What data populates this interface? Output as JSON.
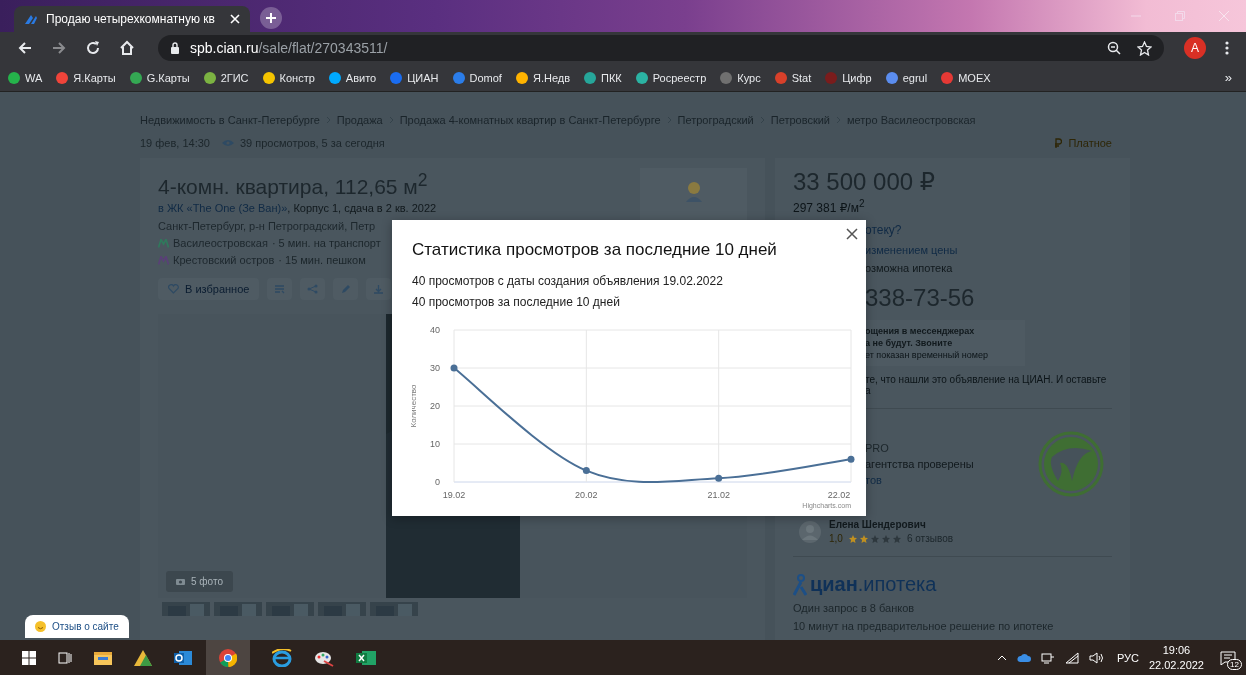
{
  "browser": {
    "tab": {
      "title": "Продаю четырехкомнатную кв",
      "selected": true
    },
    "url": {
      "host": "spb.cian.ru",
      "path": "/sale/flat/270343511/"
    },
    "profile_initial": "A",
    "bookmarks": [
      {
        "label": "WA",
        "color": "#25b34b"
      },
      {
        "label": "Я.Карты",
        "color": "#f0443a"
      },
      {
        "label": "G.Карты",
        "color": "#34a853"
      },
      {
        "label": "2ГИС",
        "color": "#7cb342"
      },
      {
        "label": "Констр",
        "color": "#f5c400"
      },
      {
        "label": "Авито",
        "color": "#00aaff"
      },
      {
        "label": "ЦИАН",
        "color": "#1a6cf0"
      },
      {
        "label": "Domof",
        "color": "#2b7de9"
      },
      {
        "label": "Я.Недв",
        "color": "#ffb300"
      },
      {
        "label": "ПКК",
        "color": "#26a69a"
      },
      {
        "label": "Росреестр",
        "color": "#2bb3a3"
      },
      {
        "label": "Курс",
        "color": "#707070"
      },
      {
        "label": "Stat",
        "color": "#d8402a"
      },
      {
        "label": "Цифр",
        "color": "#7a1c1c"
      },
      {
        "label": "egrul",
        "color": "#5b8def"
      },
      {
        "label": "MOEX",
        "color": "#e53935"
      }
    ],
    "bookmarks_more": "»"
  },
  "page": {
    "breadcrumbs": [
      "Недвижимость в Санкт-Петербурге",
      "Продажа",
      "Продажа 4-комнатных квартир в Санкт-Петербурге",
      "Петроградский",
      "Петровский",
      "метро Василеостровская"
    ],
    "published": "19 фев, 14:30",
    "views": "39 просмотров, 5 за сегодня",
    "paid_label": "Платное",
    "listing": {
      "title": "4-комн. квартира, 112,65 м$^{2}$",
      "complex_link": "в ЖК «The One (Зе Ван)»",
      "complex_details": ", Корпус 1, сдача в 2 кв. 2022",
      "address": "Санкт-Петербург, р-н Петроградский, Петр",
      "metro": [
        {
          "station": "Василеостровская",
          "time": "· 5 мин. на транспорт",
          "color": "#2f7a5c"
        },
        {
          "station": "Крестовский остров",
          "time": "· 15 мин. пешком",
          "color": "#5a3f78"
        }
      ],
      "favorite_button": "В избранное",
      "photo_count": "5 фото"
    },
    "side": {
      "price": "33 500 000 ₽",
      "price_per_m2": "297 381 ₽/м$^{2}$",
      "mortgage_link": "отеку?",
      "price_watch_link": "изменением цены",
      "mortgage_note": "озможна ипотека",
      "phone": "338-73-56",
      "messenger_notice": [
        "ощения в мессенджерах",
        "а не будут. Звоните",
        "ет показан временный номер"
      ],
      "call_note": [
        "те, что нашли это объявление на ЦИАН. И оставьте",
        "а"
      ],
      "agency": {
        "badge": "PRO",
        "verified": "агентства проверены",
        "link": "тов"
      },
      "agent": {
        "name": "Елена Шендерович",
        "rating": "1,0",
        "stars": 2,
        "reviews": "6 отзывов"
      },
      "mortgage_promo": {
        "brand": "циан",
        "product": ".ипотека",
        "lines": [
          "Один запрос в 8 банков",
          "10 минут на предварительное решение по ипотеке"
        ]
      }
    },
    "feedback_button": "Отзыв о сайте"
  },
  "modal": {
    "title": "Статистика просмотров за последние 10 дней",
    "lines": [
      "40 просмотров с даты создания объявления 19.02.2022",
      "40 просмотров за последние 10 дней"
    ],
    "chart_data": {
      "type": "line",
      "ylabel": "Количество",
      "categories": [
        "19.02",
        "20.02",
        "21.02",
        "22.02"
      ],
      "values": [
        30,
        3,
        1,
        6
      ],
      "ylim": [
        0,
        40
      ],
      "yticks": [
        0,
        10,
        20,
        30,
        40
      ],
      "grid": true,
      "marker": true
    },
    "credits": "Highcharts.com"
  },
  "taskbar": {
    "language": "РУС",
    "time": "19:06",
    "date": "22.02.2022",
    "notifications": "12"
  }
}
